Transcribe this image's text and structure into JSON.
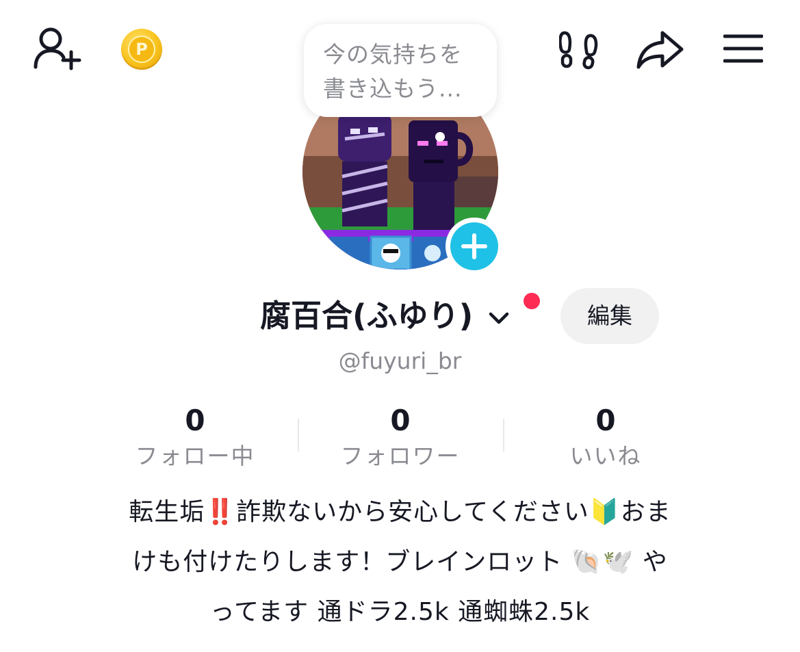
{
  "header": {
    "add_friend_icon": "person-plus-icon",
    "coin_icon": "coin-icon",
    "coin_letter": "P",
    "footprints_icon": "footprints-icon",
    "share_icon": "share-arrow-icon",
    "menu_icon": "hamburger-menu-icon"
  },
  "status_bubble": {
    "line1": "今の気持ちを",
    "line2": "書き込もう..."
  },
  "profile": {
    "display_name": "腐百合(ふゆり)",
    "chevron": "⌄",
    "edit_label": "編集",
    "username": "@fuyuri_br"
  },
  "stats": [
    {
      "value": "0",
      "label": "フォロー中"
    },
    {
      "value": "0",
      "label": "フォロワー"
    },
    {
      "value": "0",
      "label": "いいね"
    }
  ],
  "bio": {
    "line1": "転生垢‼️詐欺ないから安心してください🔰おま",
    "line2": "けも付けたりします！ブレインロット 🐚🕊️ や",
    "line3": "ってます 通ドラ2.5k 通蜘蛛2.5k"
  },
  "colors": {
    "accent_blue": "#20c1e6",
    "notification_red": "#fe2c55",
    "secondary_text": "#8a8b91",
    "button_bg": "#f1f1f2"
  }
}
